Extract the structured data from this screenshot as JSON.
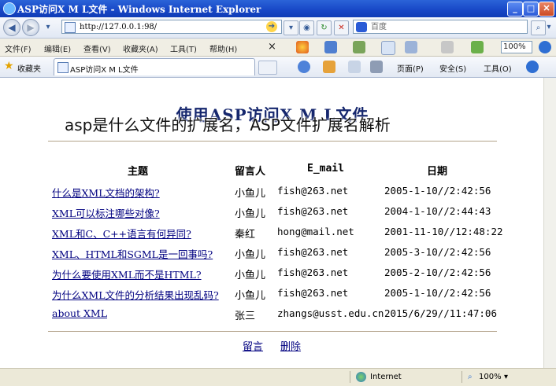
{
  "window": {
    "title": "ASP访问X M L文件 - Windows Internet Explorer",
    "min_glyph": "_",
    "max_glyph": "□",
    "close_glyph": "✕"
  },
  "address_bar": {
    "url": "http://127.0.0.1:98/",
    "search_placeholder": "百度",
    "glyphs": {
      "back": "◀",
      "forward": "▶",
      "dropdown": "▾",
      "go": "➔",
      "rss": "◉",
      "refresh": "↻",
      "stop": "✕",
      "search": "⌕"
    }
  },
  "menu": {
    "items": [
      "文件(F)",
      "编辑(E)",
      "查看(V)",
      "收藏夹(A)",
      "工具(T)",
      "帮助(H)"
    ],
    "close_glyph": "×",
    "zoom": "100%"
  },
  "favorites_bar": {
    "favorites_label": "收藏夹",
    "tab_title": "ASP访问X M L文件",
    "commands": [
      "页面(P)",
      "安全(S)",
      "工具(O)"
    ]
  },
  "page": {
    "title": "使用ASP访问X M L文件",
    "columns": [
      "主题",
      "留言人",
      "E_mail",
      "日期"
    ],
    "rows": [
      {
        "subject": "什么是XML文档的架构?",
        "author": "小鱼儿",
        "email": "fish@263.net",
        "date": "2005-1-10//2:42:56"
      },
      {
        "subject": "XML可以标注哪些对像?",
        "author": "小鱼儿",
        "email": "fish@263.net",
        "date": "2004-1-10//2:44:43"
      },
      {
        "subject": "XML和C、C++语言有何异同?",
        "author": "秦红",
        "email": "hong@mail.net",
        "date": "2001-11-10//12:48:22"
      },
      {
        "subject": "XML、HTML和SGML是一回事吗?",
        "author": "小鱼儿",
        "email": "fish@263.net",
        "date": "2005-3-10//2:42:56"
      },
      {
        "subject": "为什么要使用XML而不是HTML?",
        "author": "小鱼儿",
        "email": "fish@263.net",
        "date": "2005-2-10//2:42:56"
      },
      {
        "subject": "为什么XML文件的分析结果出现乱码?",
        "author": "小鱼儿",
        "email": "fish@263.net",
        "date": "2005-1-10//2:42:56"
      },
      {
        "subject": "about XML",
        "author": "张三",
        "email": "zhangs@usst.edu.cn",
        "date": "2015/6/29//11:47:06"
      }
    ],
    "footer_links": [
      "留言",
      "删除"
    ]
  },
  "overlay_caption": "asp是什么文件的扩展名，ASP文件扩展名解析",
  "status_bar": {
    "zone": "Internet",
    "zoom": "100%"
  }
}
